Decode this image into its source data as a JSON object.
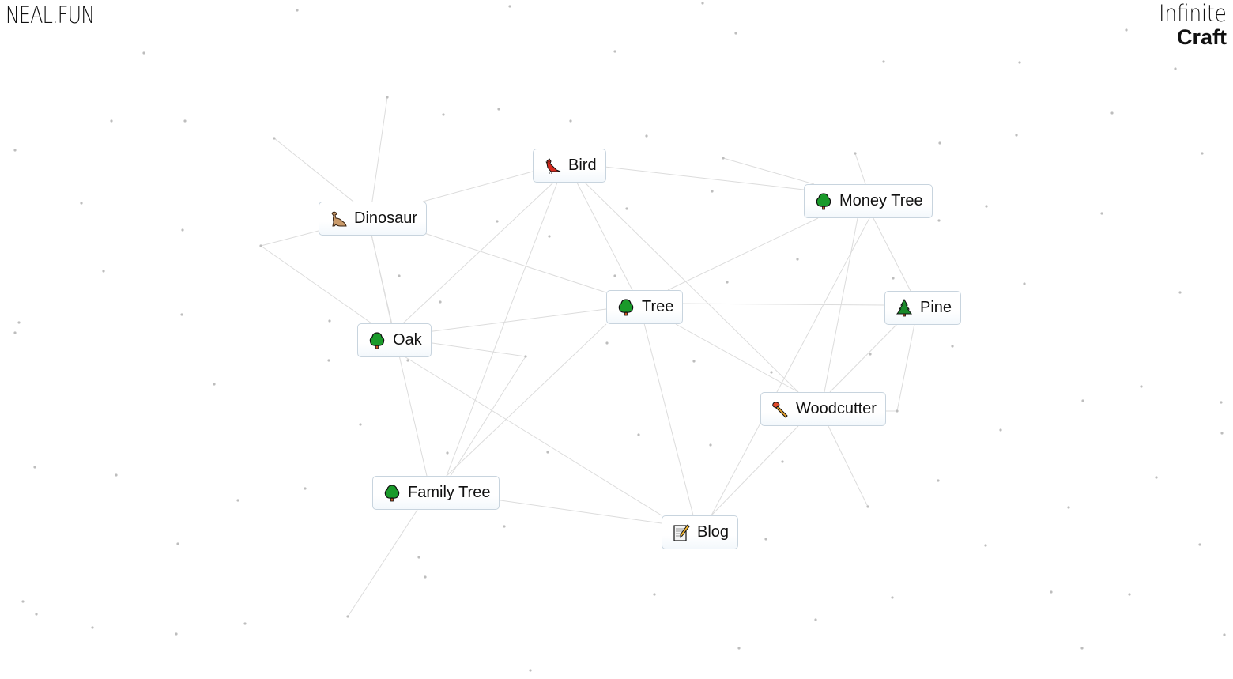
{
  "header": {
    "logo": "NEAL.FUN",
    "brand_line1": "Infinite",
    "brand_line2": "Craft"
  },
  "colors": {
    "background": "#ffffff",
    "item_border": "#c8d4de",
    "line": "#dcdcdc",
    "dot": "#bdbdbd",
    "text": "#111111"
  },
  "elements": [
    {
      "id": "bird",
      "label": "Bird",
      "icon": "cardinal-bird-icon"
    },
    {
      "id": "dinosaur",
      "label": "Dinosaur",
      "icon": "dinosaur-icon"
    },
    {
      "id": "money-tree",
      "label": "Money Tree",
      "icon": "tree-icon"
    },
    {
      "id": "tree",
      "label": "Tree",
      "icon": "tree-icon"
    },
    {
      "id": "pine",
      "label": "Pine",
      "icon": "pine-tree-icon"
    },
    {
      "id": "oak",
      "label": "Oak",
      "icon": "tree-icon"
    },
    {
      "id": "woodcutter",
      "label": "Woodcutter",
      "icon": "axe-icon"
    },
    {
      "id": "family-tree",
      "label": "Family Tree",
      "icon": "tree-icon"
    },
    {
      "id": "blog",
      "label": "Blog",
      "icon": "memo-icon"
    }
  ]
}
